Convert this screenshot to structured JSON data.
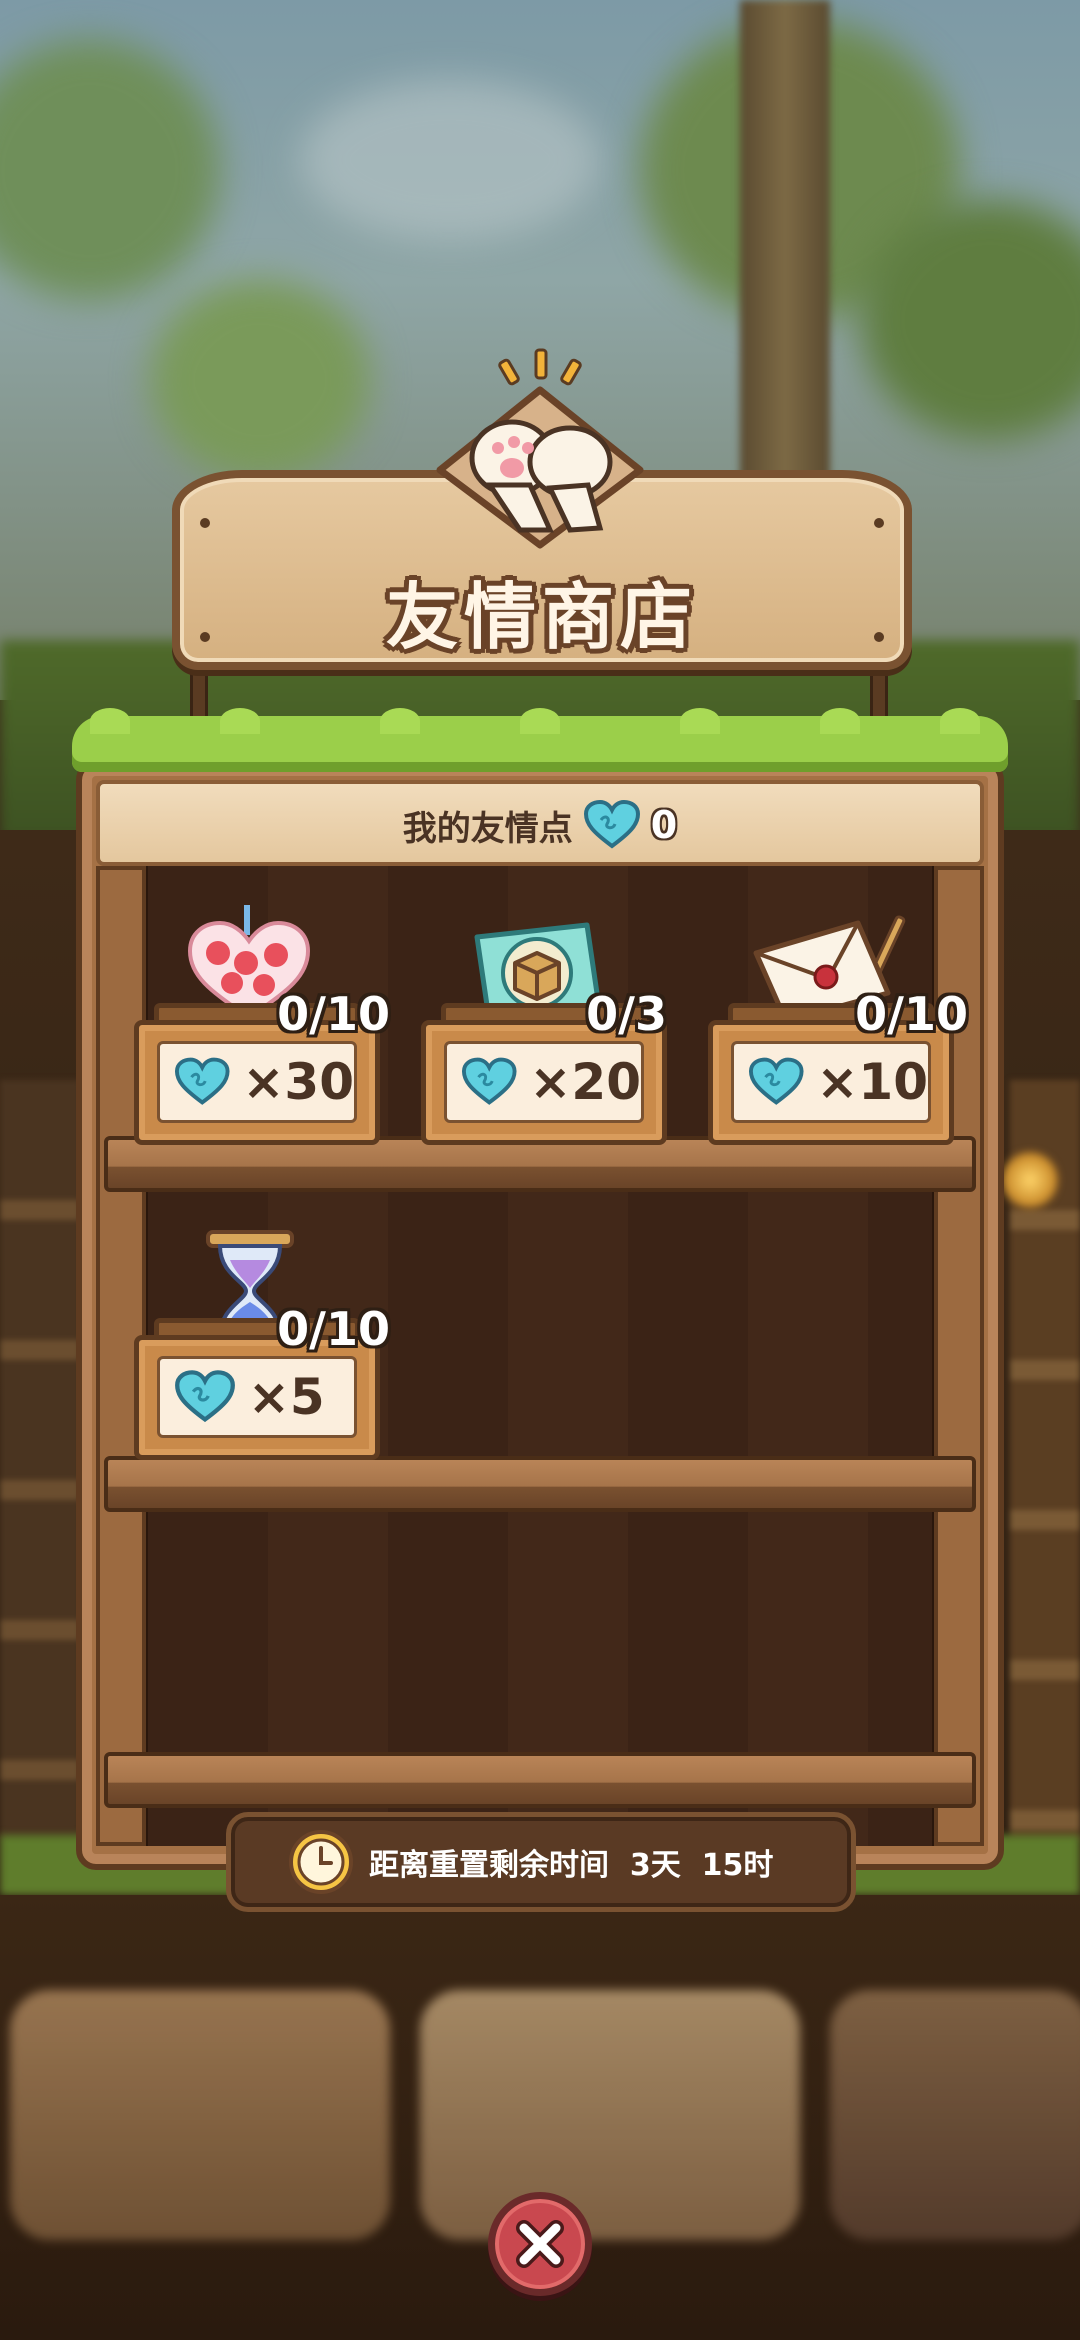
{
  "shop": {
    "title": "友情商店",
    "points_label": "我的友情点",
    "points_value": "0"
  },
  "items": [
    {
      "name": "strawberry-cake",
      "price": "×30",
      "count": "0/10"
    },
    {
      "name": "mystery-box-ticket",
      "price": "×20",
      "count": "0/3"
    },
    {
      "name": "letter",
      "price": "×10",
      "count": "0/10"
    },
    {
      "name": "hourglass",
      "price": "×5",
      "count": "0/10"
    }
  ],
  "timer": {
    "text": "距离重置剩余时间  3天  15时"
  },
  "icons": {
    "currency": "heart-icon",
    "timer": "clock-icon",
    "close": "close-icon",
    "emblem": "paw-handshake-icon"
  },
  "colors": {
    "heart": "#5fd0e0",
    "close_button": "#c9484f",
    "grass": "#9bcf4a"
  }
}
